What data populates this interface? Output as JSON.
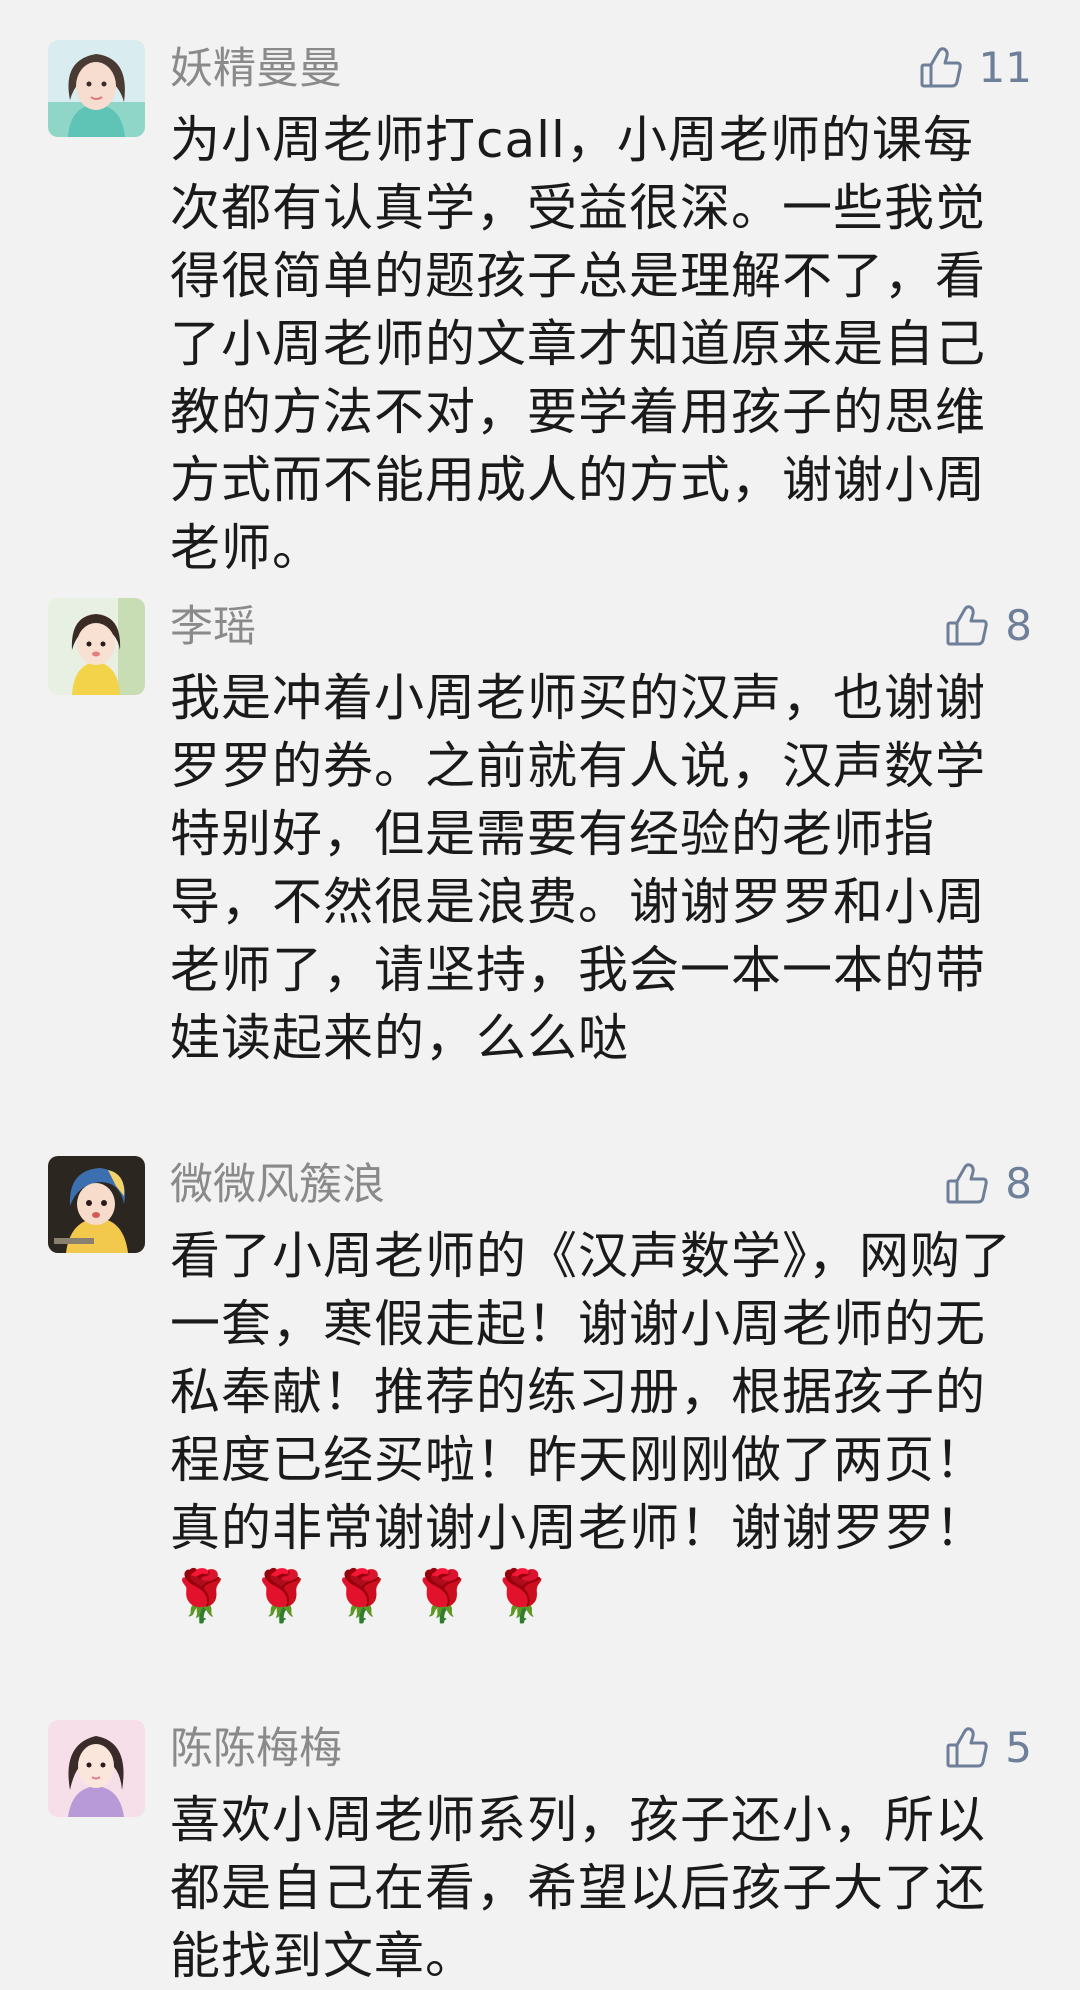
{
  "comments": [
    {
      "username": "妖精曼曼",
      "likes": "11",
      "text": "为小周老师打call，小周老师的课每次都有认真学，受益很深。一些我觉得很简单的题孩子总是理解不了，看了小周老师的文章才知道原来是自己教的方法不对，要学着用孩子的思维方式而不能用成人的方式，谢谢小周老师。"
    },
    {
      "username": "李瑶",
      "likes": "8",
      "text": "我是冲着小周老师买的汉声，也谢谢罗罗的券。之前就有人说，汉声数学特别好，但是需要有经验的老师指导，不然很是浪费。谢谢罗罗和小周老师了，请坚持，我会一本一本的带娃读起来的，么么哒"
    },
    {
      "username": "微微风簇浪",
      "likes": "8",
      "text": "看了小周老师的《汉声数学》，网购了一套，寒假走起！谢谢小周老师的无私奉献！推荐的练习册，根据孩子的程度已经买啦！昨天刚刚做了两页！真的非常谢谢小周老师！谢谢罗罗！ 🌹 🌹 🌹 🌹 🌹"
    },
    {
      "username": "陈陈梅梅",
      "likes": "5",
      "text": "喜欢小周老师系列，孩子还小，所以都是自己在看，希望以后孩子大了还能找到文章。"
    }
  ],
  "icons": {
    "like": "thumbs-up-outline-icon"
  },
  "colors": {
    "background": "#f2f2f2",
    "username": "#8a8a8a",
    "text": "#1a1a1a",
    "like": "#6e7f9a"
  }
}
